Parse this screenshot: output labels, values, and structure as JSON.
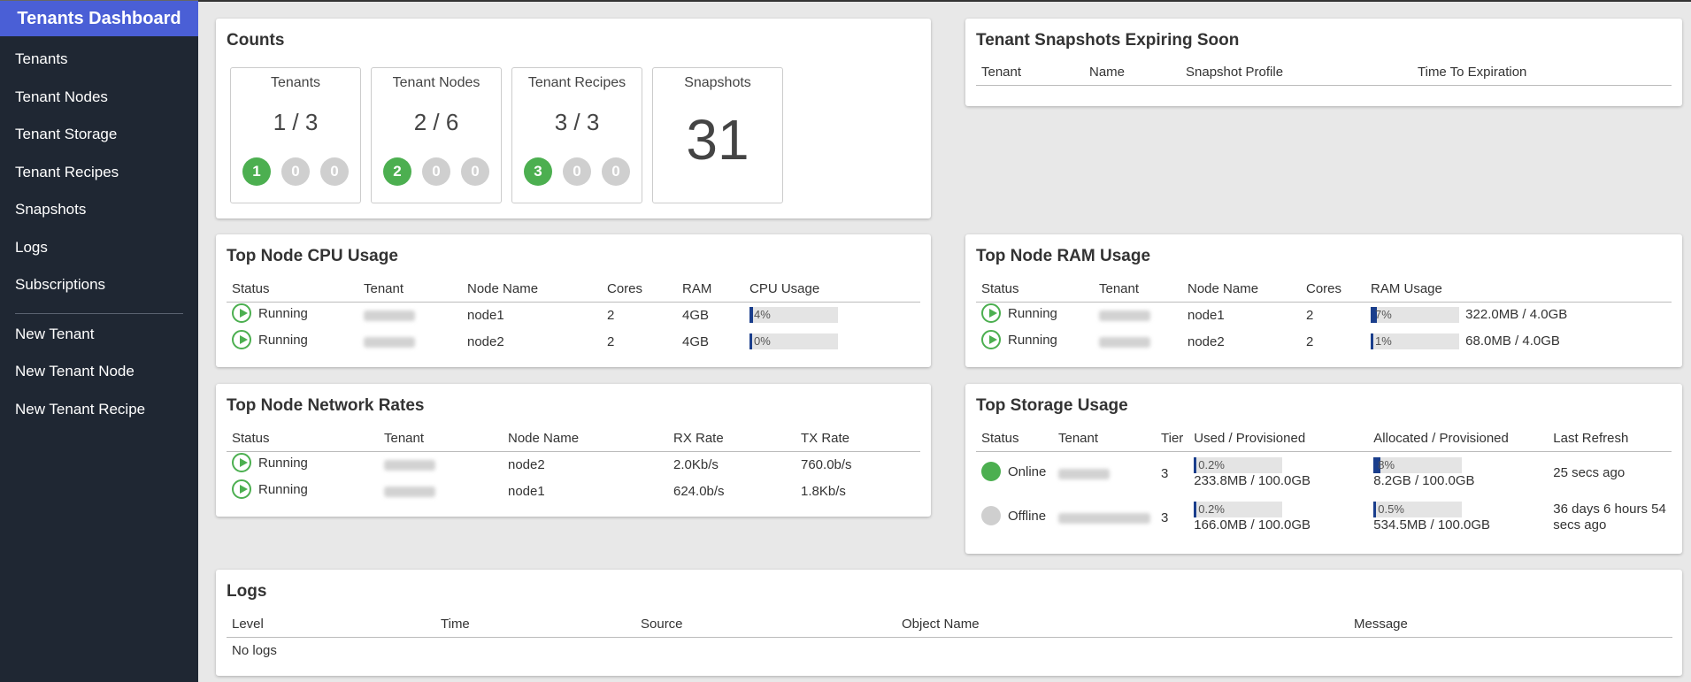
{
  "app": {
    "title": "Tenants Dashboard"
  },
  "sidebar": {
    "items": [
      {
        "label": "Tenants"
      },
      {
        "label": "Tenant Nodes"
      },
      {
        "label": "Tenant Storage"
      },
      {
        "label": "Tenant Recipes"
      },
      {
        "label": "Snapshots"
      },
      {
        "label": "Logs"
      },
      {
        "label": "Subscriptions"
      }
    ],
    "actions": [
      {
        "label": "New Tenant"
      },
      {
        "label": "New Tenant Node"
      },
      {
        "label": "New Tenant Recipe"
      }
    ]
  },
  "counts": {
    "title": "Counts",
    "boxes": [
      {
        "label": "Tenants",
        "value": "1 / 3",
        "badges": [
          "1",
          "0",
          "0"
        ]
      },
      {
        "label": "Tenant Nodes",
        "value": "2 / 6",
        "badges": [
          "2",
          "0",
          "0"
        ]
      },
      {
        "label": "Tenant Recipes",
        "value": "3 / 3",
        "badges": [
          "3",
          "0",
          "0"
        ]
      },
      {
        "label": "Snapshots",
        "value": "31"
      }
    ],
    "colors": {
      "ok": "#4caf50",
      "neutral": "#cfcfcf"
    }
  },
  "snapshots": {
    "title": "Tenant Snapshots Expiring Soon",
    "headers": [
      "Tenant",
      "Name",
      "Snapshot Profile",
      "Time To Expiration"
    ]
  },
  "cpu": {
    "title": "Top Node CPU Usage",
    "headers": [
      "Status",
      "Tenant",
      "Node Name",
      "Cores",
      "RAM",
      "CPU Usage"
    ],
    "rows": [
      {
        "status": "Running",
        "node": "node1",
        "cores": "2",
        "ram": "4GB",
        "usage": "4%",
        "usage_fraction": 0.04
      },
      {
        "status": "Running",
        "node": "node2",
        "cores": "2",
        "ram": "4GB",
        "usage": "0%",
        "usage_fraction": 0.0
      }
    ]
  },
  "ram": {
    "title": "Top Node RAM Usage",
    "headers": [
      "Status",
      "Tenant",
      "Node Name",
      "Cores",
      "RAM Usage"
    ],
    "rows": [
      {
        "status": "Running",
        "node": "node1",
        "cores": "2",
        "usage": "7%",
        "usage_fraction": 0.07,
        "detail": "322.0MB / 4.0GB"
      },
      {
        "status": "Running",
        "node": "node2",
        "cores": "2",
        "usage": "1%",
        "usage_fraction": 0.01,
        "detail": "68.0MB / 4.0GB"
      }
    ]
  },
  "network": {
    "title": "Top Node Network Rates",
    "headers": [
      "Status",
      "Tenant",
      "Node Name",
      "RX Rate",
      "TX Rate"
    ],
    "rows": [
      {
        "status": "Running",
        "node": "node2",
        "rx": "2.0Kb/s",
        "tx": "760.0b/s"
      },
      {
        "status": "Running",
        "node": "node1",
        "rx": "624.0b/s",
        "tx": "1.8Kb/s"
      }
    ]
  },
  "storage": {
    "title": "Top Storage Usage",
    "headers": [
      "Status",
      "Tenant",
      "Tier",
      "Used / Provisioned",
      "Allocated / Provisioned",
      "Last Refresh"
    ],
    "rows": [
      {
        "status": "Online",
        "status_color": "#4caf50",
        "tier": "3",
        "used_pct": "0.2%",
        "used_fraction": 0.002,
        "used": "233.8MB / 100.0GB",
        "alloc_pct": "8%",
        "alloc_fraction": 0.08,
        "alloc": "8.2GB / 100.0GB",
        "refresh": "25 secs ago"
      },
      {
        "status": "Offline",
        "status_color": "#cfcfcf",
        "tier": "3",
        "used_pct": "0.2%",
        "used_fraction": 0.002,
        "used": "166.0MB / 100.0GB",
        "alloc_pct": "0.5%",
        "alloc_fraction": 0.005,
        "alloc": "534.5MB / 100.0GB",
        "refresh": "36 days 6 hours 54 secs ago"
      }
    ]
  },
  "logs": {
    "title": "Logs",
    "headers": [
      "Level",
      "Time",
      "Source",
      "Object Name",
      "Message"
    ],
    "empty": "No logs"
  }
}
